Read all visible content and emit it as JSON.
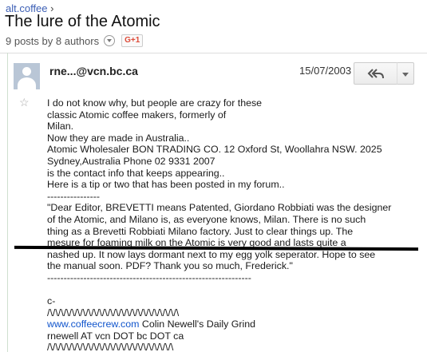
{
  "breadcrumb": {
    "group": "alt.coffee",
    "separator": "›"
  },
  "thread": {
    "title": "The lure of the Atomic",
    "meta": "9 posts by 8 authors",
    "gplus_label": "G+1"
  },
  "message": {
    "sender": "rne...@vcn.bc.ca",
    "date": "15/07/2003",
    "lines": [
      "I do not know why, but people are crazy for these",
      "classic Atomic coffee makers, formerly of",
      "Milan.",
      "Now they are made in Australia..",
      "Atomic Wholesaler BON TRADING CO. 12 Oxford St, Woollahra NSW. 2025",
      "Sydney,Australia Phone 02 9331 2007",
      "is the contact info that keeps appearing..",
      "Here is a tip or two that has been posted in my forum..",
      "----------------",
      "\"Dear Editor, BREVETTI means Patented, Giordano Robbiati was the designer",
      "of the Atomic, and Milano is, as everyone knows, Milan. There is no such",
      "thing as a Brevetti Robbiati Milano factory. Just to clear things up. The",
      "mesure for foaming milk on the Atomic is very good and lasts quite a",
      "nashed up. It now lays dormant next to my egg yolk seperator. Hope to see",
      "the manual soon. PDF? Thank you so much, Frederick.\"",
      "--------------------------------------------------------------"
    ],
    "signature": {
      "dash": "c-",
      "wave1": "/\\/\\/\\/\\/\\/\\/\\/\\/\\/\\/\\/\\/\\/\\/\\/\\/\\/\\/\\/\\/\\/\\/\\/\\",
      "link": "www.coffeecrew.com",
      "link_suffix": " Colin Newell's Daily Grind",
      "email": "rnewell AT vcn DOT bc DOT ca",
      "wave2": "/\\/\\/\\/\\/\\/\\/\\/\\/\\/\\/\\/\\/\\/\\/\\/\\/\\/\\/\\/\\/\\/\\/\\"
    }
  },
  "icons": {
    "avatar": "user-avatar-icon",
    "reply": "reply-all-icon",
    "more": "chevron-down-icon",
    "star": "star-icon"
  }
}
